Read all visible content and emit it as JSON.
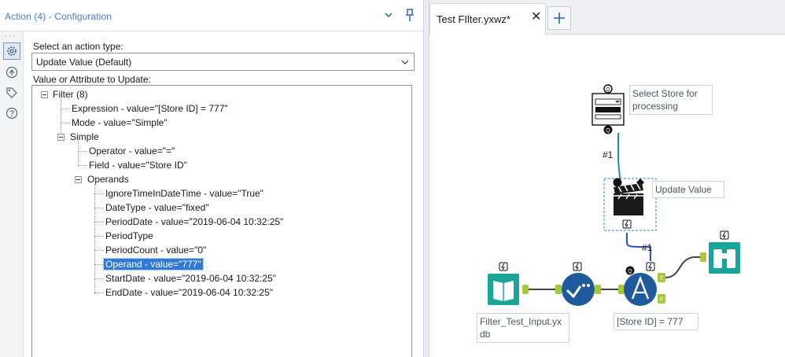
{
  "config": {
    "title": "Action (4) - Configuration",
    "action_type_label": "Select an action type:",
    "action_type_value": "Update Value (Default)",
    "value_attr_label": "Value or Attribute to Update:",
    "tree": {
      "filter": "Filter (8)",
      "expression": "Expression - value=\"[Store ID] = 777\"",
      "mode": "Mode - value=\"Simple\"",
      "simple": "Simple",
      "operator": "Operator - value=\"=\"",
      "field": "Field - value=\"Store ID\"",
      "operands": "Operands",
      "ignore_time": "IgnoreTimeInDateTime - value=\"True\"",
      "date_type": "DateType - value=\"fixed\"",
      "period_date": "PeriodDate - value=\"2019-06-04 10:32:25\"",
      "period_type": "PeriodType",
      "period_count": "PeriodCount - value=\"0\"",
      "operand": "Operand - value=\"777\"",
      "start_date": "StartDate - value=\"2019-06-04 10:32:25\"",
      "end_date": "EndDate - value=\"2019-06-04 10:32:25\""
    }
  },
  "canvas": {
    "tab_label": "Test FIlter.yxwz*",
    "tab_close": "✕",
    "tab_add": "+",
    "nodes": {
      "dropdown_label": "Select Store for processing",
      "action_label": "Update Value",
      "input_label": "Filter_Test_Input.yxdb",
      "filter_label": "[Store ID] = 777"
    },
    "connection_labels": {
      "c1": "#1",
      "c2": "#1"
    },
    "anchors": {
      "q": "Q",
      "t": "T",
      "f": "F"
    }
  },
  "colors": {
    "teal": "#1aa59a",
    "navy": "#1f5b9c",
    "green_anchor": "#a6c83b",
    "selection": "#2f7ad6"
  }
}
